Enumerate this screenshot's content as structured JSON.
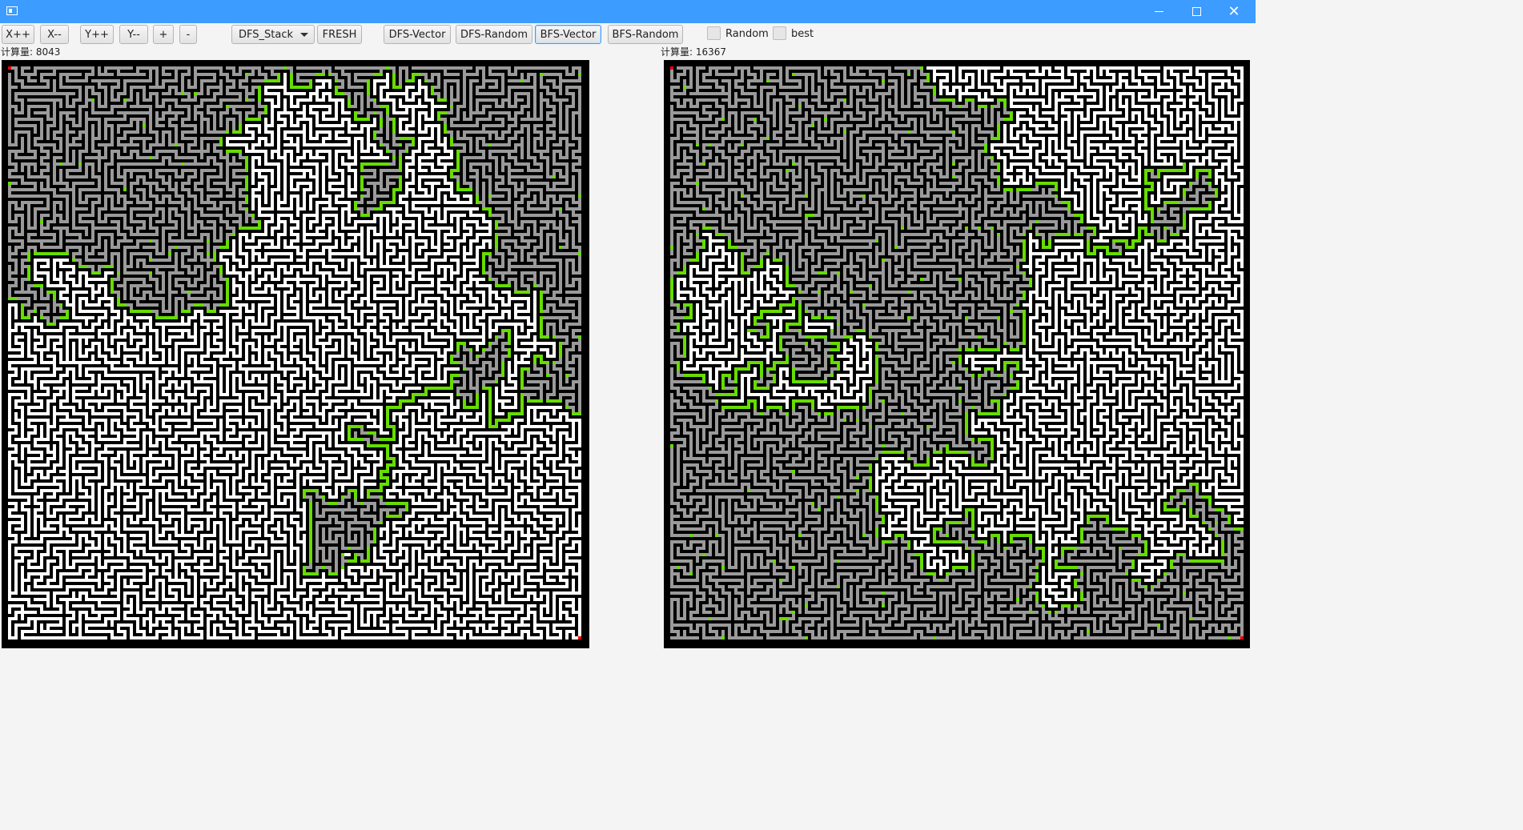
{
  "toolbar": {
    "buttons": [
      "X++",
      "X--",
      "Y++",
      "Y--",
      "+",
      "-"
    ],
    "algorithm_select": "DFS_Stack",
    "fresh": "FRESH",
    "modes": [
      "DFS-Vector",
      "DFS-Random",
      "BFS-Vector",
      "BFS-Random"
    ],
    "active_mode": "BFS-Vector",
    "checkboxes": [
      "Random",
      "best"
    ]
  },
  "left_panel": {
    "label": "计算量: 8043"
  },
  "right_panel": {
    "label": "计算量: 16367"
  },
  "colors": {
    "titlebar": "#3c9cff",
    "path": "#66dd00",
    "visited": "#9a9a9a",
    "wall": "#000000",
    "open": "#ffffff",
    "marker": "#ff0000"
  },
  "icons": [
    "app-icon",
    "minimize-icon",
    "maximize-icon",
    "close-icon",
    "dropdown-arrow-icon"
  ]
}
